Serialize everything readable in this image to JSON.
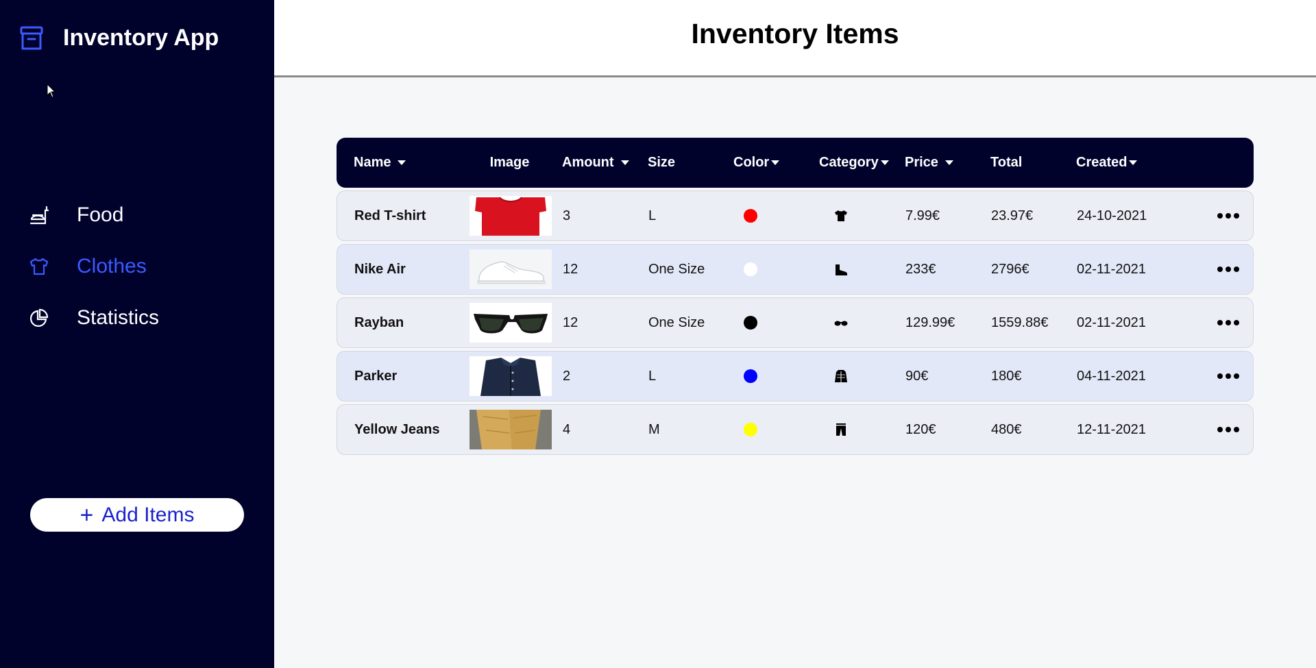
{
  "app": {
    "title": "Inventory App"
  },
  "header": {
    "title": "Inventory Items"
  },
  "sidebar": {
    "items": [
      {
        "label": "Food",
        "icon": "food-icon",
        "active": false
      },
      {
        "label": "Clothes",
        "icon": "shirt-icon",
        "active": true
      },
      {
        "label": "Statistics",
        "icon": "pie-chart-icon",
        "active": false
      }
    ],
    "add_label": "Add Items",
    "add_icon": "+"
  },
  "colors": {
    "sidebar_bg": "#01022c",
    "accent": "#3b5bff",
    "add_text": "#1a22cc"
  },
  "table": {
    "columns": {
      "name": "Name",
      "image": "Image",
      "amount": "Amount",
      "size": "Size",
      "color": "Color",
      "category": "Category",
      "price": "Price",
      "total": "Total",
      "created": "Created"
    },
    "rows": [
      {
        "name": "Red T-shirt",
        "image": "red-tshirt-image",
        "amount": "3",
        "size": "L",
        "color": "#ff0000",
        "category": "tshirt-icon",
        "price": "7.99€",
        "total": "23.97€",
        "created": "24-10-2021"
      },
      {
        "name": "Nike Air",
        "image": "white-sneaker-image",
        "amount": "12",
        "size": "One Size",
        "color": "#ffffff",
        "category": "shoe-icon",
        "price": "233€",
        "total": "2796€",
        "created": "02-11-2021"
      },
      {
        "name": "Rayban",
        "image": "sunglasses-image",
        "amount": "12",
        "size": "One Size",
        "color": "#000000",
        "category": "glasses-icon",
        "price": "129.99€",
        "total": "1559.88€",
        "created": "02-11-2021"
      },
      {
        "name": "Parker",
        "image": "navy-jacket-image",
        "amount": "2",
        "size": "L",
        "color": "#0000ff",
        "category": "jacket-icon",
        "price": "90€",
        "total": "180€",
        "created": "04-11-2021"
      },
      {
        "name": "Yellow Jeans",
        "image": "yellow-jeans-image",
        "amount": "4",
        "size": "M",
        "color": "#ffff00",
        "category": "pants-icon",
        "price": "120€",
        "total": "480€",
        "created": "12-11-2021"
      }
    ]
  }
}
